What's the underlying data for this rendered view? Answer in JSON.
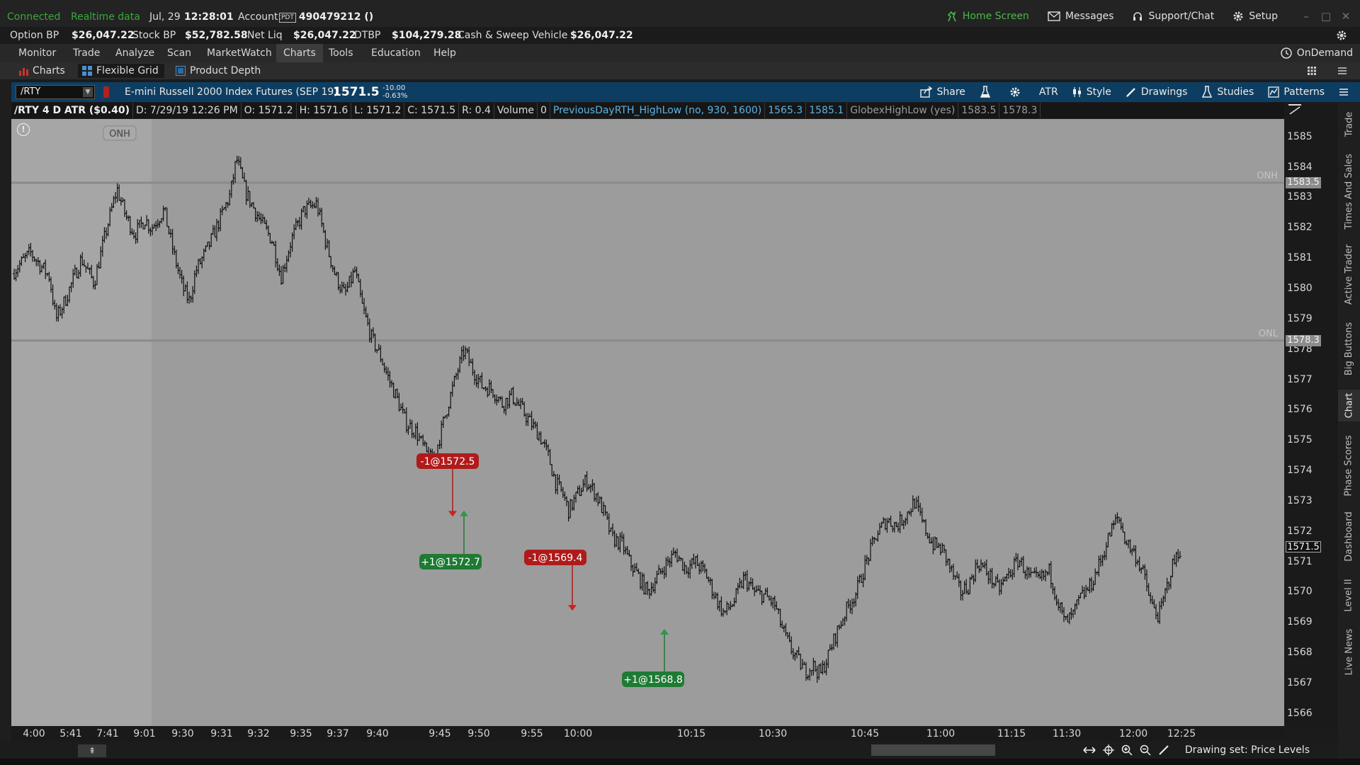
{
  "status": {
    "connection": "Connected",
    "data_feed": "Realtime data",
    "date": "Jul, 29",
    "time": "12:28:01",
    "account_label": "Account:",
    "account_badge": "PDT",
    "account_number": "490479212 ()"
  },
  "top_actions": {
    "home": "Home Screen",
    "messages": "Messages",
    "support": "Support/Chat",
    "setup": "Setup"
  },
  "balances": [
    {
      "label": "Option BP",
      "value": "$26,047.22"
    },
    {
      "label": "Stock BP",
      "value": "$52,782.58"
    },
    {
      "label": "Net Liq",
      "value": "$26,047.22"
    },
    {
      "label": "DTBP",
      "value": "$104,279.28"
    },
    {
      "label": "Cash & Sweep Vehicle",
      "value": "$26,047.22"
    }
  ],
  "menu": [
    "Monitor",
    "Trade",
    "Analyze",
    "Scan",
    "MarketWatch",
    "Charts",
    "Tools",
    "Education",
    "Help"
  ],
  "menu_active": "Charts",
  "ondemand": "OnDemand",
  "subtabs": {
    "charts": "Charts",
    "flexible_grid": "Flexible Grid",
    "product_depth": "Product Depth"
  },
  "chart_header": {
    "symbol": "/RTY",
    "description": "E-mini Russell 2000 Index Futures (SEP 19)",
    "last": "1571.5",
    "change": "-10.00",
    "change_pct": "-0.63%",
    "tools": {
      "share": "Share",
      "atr": "ATR",
      "style": "Style",
      "drawings": "Drawings",
      "studies": "Studies",
      "patterns": "Patterns"
    }
  },
  "study_line": {
    "title": "/RTY 4 D ATR ($0.40)",
    "d": "D: 7/29/19 12:26 PM",
    "o": "O: 1571.2",
    "h": "H: 1571.6",
    "l": "L: 1571.2",
    "c": "C: 1571.5",
    "r": "R: 0.4",
    "volume_label": "Volume",
    "volume": "0",
    "study1": "PreviousDayRTH_HighLow (no, 930, 1600)",
    "study1_v1": "1565.3",
    "study1_v2": "1585.1",
    "study2": "GlobexHighLow (yes)",
    "study2_v1": "1583.5",
    "study2_v2": "1578.3"
  },
  "chart_data": {
    "type": "bar",
    "x": [
      "4:00",
      "5:41",
      "7:41",
      "9:01",
      "9:30",
      "9:31",
      "9:32",
      "9:35",
      "9:37",
      "9:40",
      "9:45",
      "9:50",
      "9:55",
      "10:00",
      "10:15",
      "10:30",
      "10:45",
      "11:00",
      "11:15",
      "11:30",
      "12:00",
      "12:25"
    ],
    "ylim": [
      1565.6,
      1585.6
    ],
    "yticks": [
      1566,
      1567,
      1568,
      1569,
      1570,
      1571,
      1572,
      1573,
      1574,
      1575,
      1576,
      1577,
      1578,
      1579,
      1580,
      1581,
      1582,
      1583,
      1584,
      1585
    ],
    "close_path": [
      [
        0.0,
        1580.5
      ],
      [
        0.015,
        1581.2
      ],
      [
        0.03,
        1580.4
      ],
      [
        0.035,
        1579.0
      ],
      [
        0.042,
        1579.6
      ],
      [
        0.055,
        1581.0
      ],
      [
        0.065,
        1580.2
      ],
      [
        0.075,
        1582.0
      ],
      [
        0.083,
        1583.3
      ],
      [
        0.09,
        1582.4
      ],
      [
        0.097,
        1581.8
      ],
      [
        0.105,
        1582.3
      ],
      [
        0.11,
        1582.0
      ],
      [
        0.12,
        1582.6
      ],
      [
        0.128,
        1581.1
      ],
      [
        0.135,
        1580.0
      ],
      [
        0.14,
        1579.6
      ],
      [
        0.145,
        1580.6
      ],
      [
        0.155,
        1581.4
      ],
      [
        0.165,
        1582.4
      ],
      [
        0.172,
        1583.1
      ],
      [
        0.177,
        1584.3
      ],
      [
        0.184,
        1583.2
      ],
      [
        0.195,
        1582.3
      ],
      [
        0.205,
        1581.6
      ],
      [
        0.212,
        1580.4
      ],
      [
        0.22,
        1581.6
      ],
      [
        0.23,
        1582.6
      ],
      [
        0.24,
        1582.8
      ],
      [
        0.248,
        1581.4
      ],
      [
        0.255,
        1580.4
      ],
      [
        0.262,
        1579.8
      ],
      [
        0.27,
        1580.6
      ],
      [
        0.276,
        1579.4
      ],
      [
        0.283,
        1578.4
      ],
      [
        0.29,
        1577.8
      ],
      [
        0.296,
        1577.1
      ],
      [
        0.303,
        1576.4
      ],
      [
        0.31,
        1575.6
      ],
      [
        0.318,
        1575.3
      ],
      [
        0.326,
        1574.6
      ],
      [
        0.331,
        1574.3
      ],
      [
        0.336,
        1575.0
      ],
      [
        0.342,
        1576.0
      ],
      [
        0.35,
        1577.2
      ],
      [
        0.356,
        1578.0
      ],
      [
        0.362,
        1577.4
      ],
      [
        0.37,
        1576.8
      ],
      [
        0.378,
        1576.7
      ],
      [
        0.386,
        1576.2
      ],
      [
        0.393,
        1576.5
      ],
      [
        0.4,
        1576.1
      ],
      [
        0.408,
        1575.6
      ],
      [
        0.415,
        1575.2
      ],
      [
        0.422,
        1574.5
      ],
      [
        0.428,
        1573.6
      ],
      [
        0.434,
        1573.2
      ],
      [
        0.438,
        1572.7
      ],
      [
        0.446,
        1573.3
      ],
      [
        0.452,
        1573.7
      ],
      [
        0.46,
        1573.2
      ],
      [
        0.466,
        1572.6
      ],
      [
        0.472,
        1571.8
      ],
      [
        0.48,
        1571.6
      ],
      [
        0.486,
        1571.0
      ],
      [
        0.492,
        1570.6
      ],
      [
        0.5,
        1570.0
      ],
      [
        0.506,
        1570.4
      ],
      [
        0.514,
        1570.9
      ],
      [
        0.522,
        1571.3
      ],
      [
        0.53,
        1570.8
      ],
      [
        0.538,
        1571.0
      ],
      [
        0.546,
        1570.6
      ],
      [
        0.553,
        1569.9
      ],
      [
        0.56,
        1569.3
      ],
      [
        0.568,
        1569.7
      ],
      [
        0.576,
        1570.5
      ],
      [
        0.584,
        1570.0
      ],
      [
        0.592,
        1569.9
      ],
      [
        0.6,
        1569.6
      ],
      [
        0.606,
        1568.8
      ],
      [
        0.612,
        1568.2
      ],
      [
        0.618,
        1567.8
      ],
      [
        0.624,
        1567.4
      ],
      [
        0.63,
        1567.6
      ],
      [
        0.636,
        1567.3
      ],
      [
        0.642,
        1567.9
      ],
      [
        0.648,
        1568.6
      ],
      [
        0.656,
        1569.4
      ],
      [
        0.664,
        1570.0
      ],
      [
        0.672,
        1571.0
      ],
      [
        0.68,
        1571.9
      ],
      [
        0.688,
        1572.4
      ],
      [
        0.696,
        1572.2
      ],
      [
        0.704,
        1572.6
      ],
      [
        0.71,
        1573.0
      ],
      [
        0.716,
        1572.3
      ],
      [
        0.724,
        1571.6
      ],
      [
        0.732,
        1571.4
      ],
      [
        0.74,
        1570.6
      ],
      [
        0.746,
        1570.0
      ],
      [
        0.752,
        1570.2
      ],
      [
        0.76,
        1571.0
      ],
      [
        0.768,
        1570.6
      ],
      [
        0.776,
        1570.1
      ],
      [
        0.784,
        1570.6
      ],
      [
        0.792,
        1571.1
      ],
      [
        0.8,
        1570.5
      ],
      [
        0.808,
        1570.4
      ],
      [
        0.816,
        1570.7
      ],
      [
        0.822,
        1569.8
      ],
      [
        0.828,
        1569.0
      ],
      [
        0.834,
        1569.2
      ],
      [
        0.84,
        1569.8
      ],
      [
        0.848,
        1570.2
      ],
      [
        0.856,
        1571.0
      ],
      [
        0.864,
        1572.0
      ],
      [
        0.87,
        1572.5
      ],
      [
        0.876,
        1571.7
      ],
      [
        0.884,
        1571.2
      ],
      [
        0.89,
        1570.6
      ],
      [
        0.896,
        1569.6
      ],
      [
        0.902,
        1569.2
      ],
      [
        0.906,
        1569.8
      ],
      [
        0.912,
        1570.8
      ],
      [
        0.918,
        1571.4
      ],
      [
        0.92,
        1571.5
      ]
    ],
    "overlay_lines": [
      {
        "label": "ONH",
        "value": 1583.5
      },
      {
        "label": "ONL",
        "value": 1578.3
      }
    ],
    "trades": [
      {
        "label": "-1@1572.5",
        "side": "sell",
        "value": 1572.5
      },
      {
        "label": "+1@1572.7",
        "side": "buy",
        "value": 1572.7
      },
      {
        "label": "-1@1569.4",
        "side": "sell",
        "value": 1569.4
      },
      {
        "label": "+1@1568.8",
        "side": "buy",
        "value": 1568.8
      }
    ],
    "onh_tag": "ONH",
    "price_boxes": [
      "1583.5",
      "1578.3",
      "1571.5"
    ]
  },
  "side_tabs": [
    "Trade",
    "Times And Sales",
    "Active Trader",
    "Big Buttons",
    "Chart",
    "Phase Scores",
    "Dashboard",
    "Level II",
    "Live News"
  ],
  "bottom": {
    "drawing_set": "Drawing set: Price Levels",
    "price_levels": "Price Levels"
  },
  "colors": {
    "accent_green": "#3aa83a",
    "header_blue": "#0d3e62",
    "sell_red": "#b01a1a",
    "buy_green": "#1f7a34",
    "chart_bg": "#9c9c9c"
  }
}
